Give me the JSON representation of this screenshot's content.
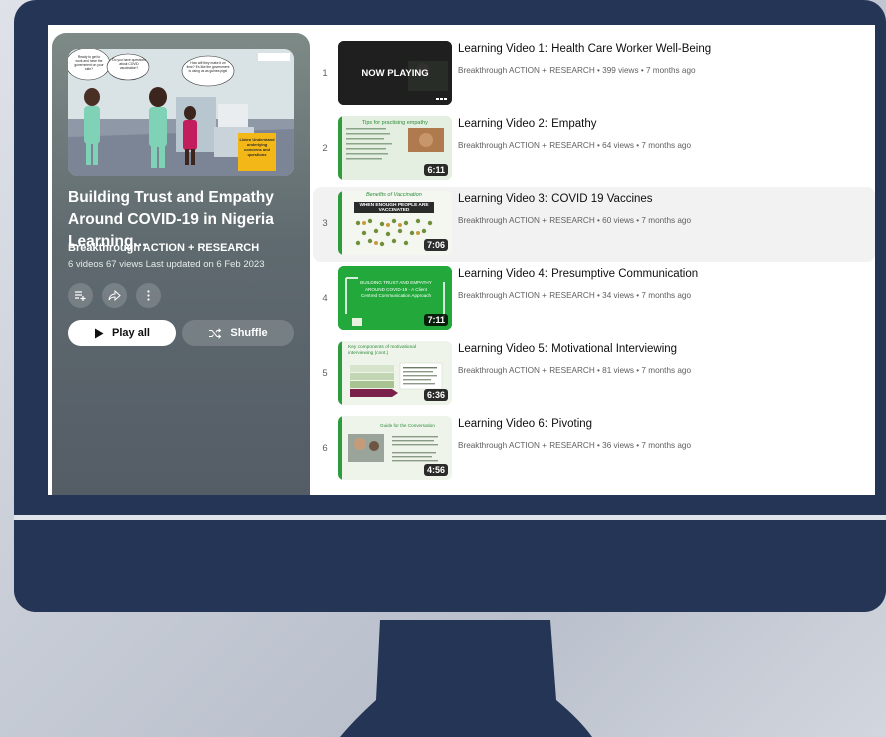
{
  "playlist": {
    "title": "Building Trust and Empathy Around COVID-19 in Nigeria Learning...",
    "owner": "Breakthrough ACTION + RESEARCH",
    "meta": "6 videos  67 views  Last updated on 6 Feb 2023",
    "play_all_label": "Play all",
    "shuffle_label": "Shuffle",
    "thumb_callout_1": "Ready to get to work and have the government on your side?",
    "thumb_callout_2": "Do you have questions about COVID vaccination?",
    "thumb_callout_3": "How will they make it on time? It's like the government is using us as guinea pigs!",
    "thumb_sign": "Listen Understand underlying concerns and questions"
  },
  "videos": [
    {
      "index": "1",
      "title": "Learning Video 1: Health Care Worker Well-Being",
      "meta": "Breakthrough ACTION + RESEARCH • 399 views • 7 months ago",
      "overlay": "NOW PLAYING",
      "duration": ""
    },
    {
      "index": "2",
      "title": "Learning Video 2: Empathy",
      "meta": "Breakthrough ACTION + RESEARCH • 64 views • 7 months ago",
      "slide": "Tips for practising empathy",
      "duration": "6:11"
    },
    {
      "index": "3",
      "title": "Learning Video 3: COVID 19 Vaccines",
      "meta": "Breakthrough ACTION + RESEARCH • 60 views • 7 months ago",
      "slide": "Benefits of Vaccination",
      "slide_sub": "WHEN ENOUGH PEOPLE ARE VACCINATED",
      "duration": "7:06"
    },
    {
      "index": "4",
      "title": "Learning Video 4: Presumptive Communication",
      "meta": "Breakthrough ACTION + RESEARCH • 34 views • 7 months ago",
      "slide": "BUILDING TRUST AND EMPATHY AROUND COVID-19 - A Client Centred Communication Approach",
      "duration": "7:11"
    },
    {
      "index": "5",
      "title": "Learning Video 5: Motivational Interviewing",
      "meta": "Breakthrough ACTION + RESEARCH • 81 views • 7 months ago",
      "slide": "Key components of motivational interviewing (cont.)",
      "duration": "6:36"
    },
    {
      "index": "6",
      "title": "Learning Video 6: Pivoting",
      "meta": "Breakthrough ACTION + RESEARCH • 36 views • 7 months ago",
      "slide": "Guide for the Conversation",
      "duration": "4:56"
    }
  ],
  "colors": {
    "monitor": "#243556",
    "panel_top": "#7d8a86",
    "panel_bottom": "#545c66",
    "slide_green": "#20a03a"
  },
  "icons": [
    "add-to-queue-icon",
    "share-icon",
    "more-icon",
    "play-icon",
    "shuffle-icon"
  ]
}
